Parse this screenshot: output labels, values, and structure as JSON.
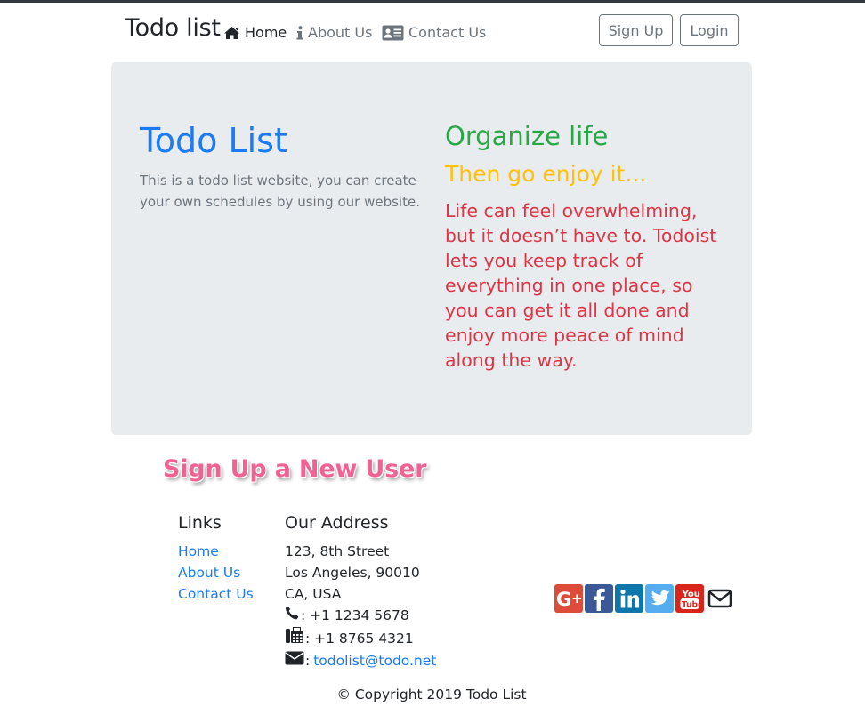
{
  "navbar": {
    "brand": "Todo list",
    "links": [
      {
        "label": "Home",
        "icon": "home-icon",
        "active": true
      },
      {
        "label": "About Us",
        "icon": "info-icon",
        "active": false
      },
      {
        "label": "Contact Us",
        "icon": "address-card-icon",
        "active": false
      }
    ],
    "signup_label": "Sign Up",
    "login_label": "Login"
  },
  "jumbotron": {
    "title": "Todo List",
    "lead": "This is a todo list website, you can create your own schedules by using our website.",
    "heading1": "Organize life",
    "heading2": "Then go enjoy it...",
    "body": "Life can feel overwhelming, but it doesn’t have to. Todoist lets you keep track of everything in one place, so you can get it all done and enjoy more peace of mind along the way."
  },
  "signup_heading": "Sign Up a New User",
  "footer": {
    "links_heading": "Links",
    "links": [
      "Home",
      "About Us",
      "Contact Us"
    ],
    "address_heading": "Our Address",
    "address_lines": [
      "123, 8th Street",
      "Los Angeles, 90010",
      "CA, USA"
    ],
    "phone": ": +1 1234 5678",
    "fax": ": +1 8765 4321",
    "email_prefix": ":",
    "email": "todolist@todo.net",
    "social": [
      {
        "icon": "google-plus-icon",
        "color": "#dd4b39"
      },
      {
        "icon": "facebook-icon",
        "color": "#3b5998"
      },
      {
        "icon": "linkedin-icon",
        "color": "#0e76a8"
      },
      {
        "icon": "twitter-icon",
        "color": "#55acee"
      },
      {
        "icon": "youtube-icon",
        "color": "#d9261c"
      },
      {
        "icon": "envelope-outline-icon",
        "color": "#212529"
      }
    ],
    "copyright": "© Copyright 2019 Todo List"
  }
}
